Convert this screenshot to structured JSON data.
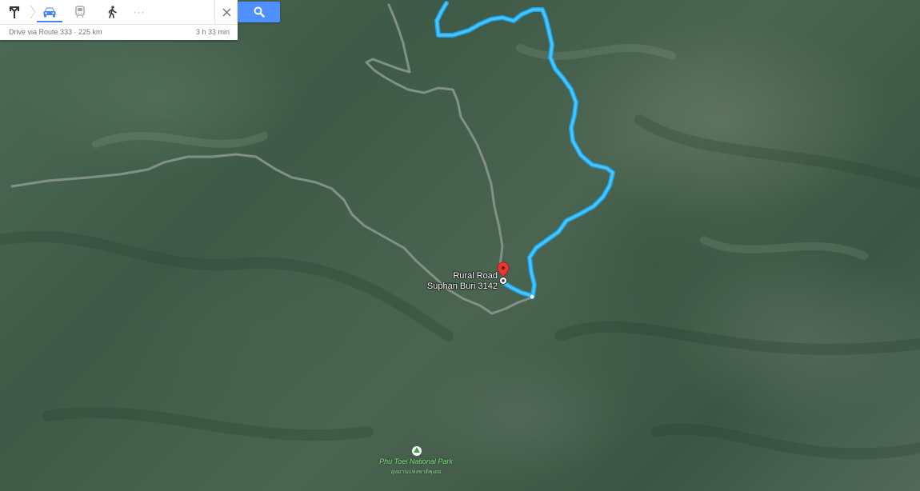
{
  "toolbar": {
    "modes": [
      {
        "name": "directions",
        "icon": "directions-sign-icon",
        "active": false
      },
      {
        "name": "driving",
        "icon": "car-icon",
        "active": true
      },
      {
        "name": "transit",
        "icon": "train-icon",
        "active": false
      },
      {
        "name": "walking",
        "icon": "walking-person-icon",
        "active": false
      },
      {
        "name": "more",
        "icon": "ellipsis-icon",
        "active": false
      }
    ],
    "more_label": "···",
    "close_icon": "close-icon",
    "search_icon": "search-icon"
  },
  "route_summary": {
    "via": "Drive via Route 333 · 225 km",
    "duration": "3 h 33 min"
  },
  "map": {
    "type": "satellite",
    "route_color": "#29b6f6",
    "destination": {
      "line1": "Rural Road",
      "line2": "Suphan Buri 3142"
    },
    "park": {
      "name": "Phu Toei National Park",
      "local_name": "อุทยานแห่งชาติพุเตย"
    }
  },
  "colors": {
    "accent": "#4285f4",
    "search_button": "#4d90fe",
    "pin": "#e53935",
    "park_label": "#7ee07e"
  }
}
